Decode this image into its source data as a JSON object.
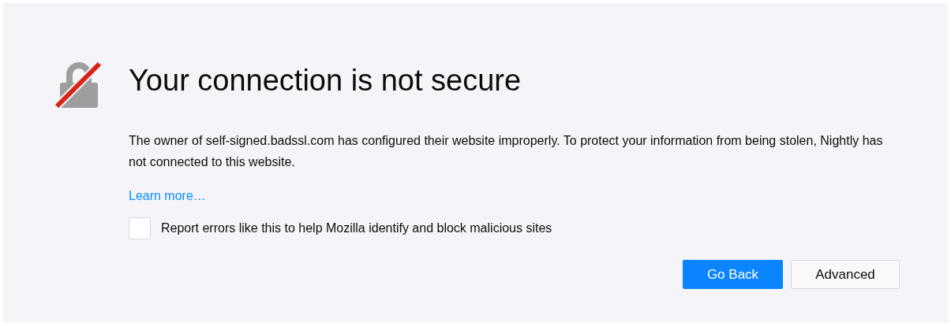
{
  "title": "Your connection is not secure",
  "description": "The owner of self-signed.badssl.com has configured their website improperly. To protect your information from being stolen, Nightly has not connected to this website.",
  "learn_more": "Learn more…",
  "report_checkbox": {
    "label": "Report errors like this to help Mozilla identify and block malicious sites",
    "checked": false
  },
  "buttons": [
    {
      "label": "Go Back",
      "kind": "primary"
    },
    {
      "label": "Advanced",
      "kind": "secondary"
    }
  ]
}
